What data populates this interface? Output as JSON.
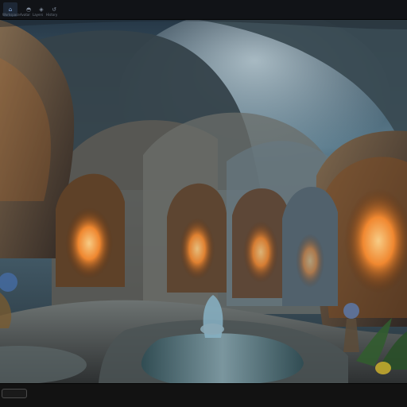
{
  "window": {
    "title": ""
  },
  "toolbar": {
    "buttons": [
      {
        "icon": "home-icon",
        "label": "Workspace"
      },
      {
        "icon": "user-icon",
        "label": "Avatar"
      },
      {
        "icon": "layers-icon",
        "label": "Layers"
      },
      {
        "icon": "history-icon",
        "label": "History"
      }
    ]
  },
  "image": {
    "alt": "Fantasy palace interior with arched halls, glowing doorways, and a central fountain",
    "colors": {
      "sky_top": "#263847",
      "sky_mid": "#5b7b8c",
      "stone": "#8b785f",
      "glow": "#ff9a35",
      "fountain": "#6ea0b7"
    }
  },
  "status": {
    "chip_text": "",
    "info_text": ""
  }
}
